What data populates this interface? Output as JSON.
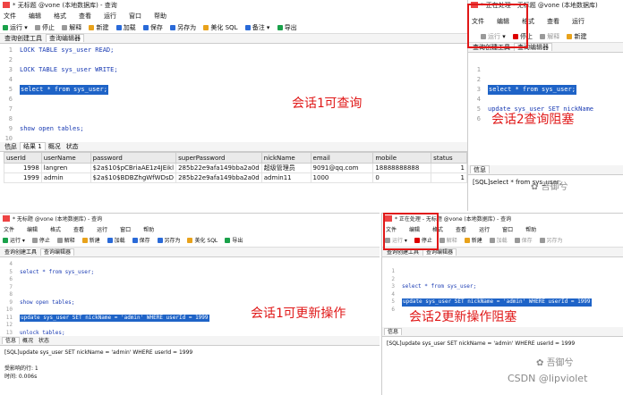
{
  "w1": {
    "title": "* 无标题 @vone (本地数据库) - 查询",
    "menu": [
      "文件",
      "编辑",
      "格式",
      "查看",
      "运行",
      "窗口",
      "帮助"
    ],
    "toolbar": [
      "运行",
      "停止",
      "解释",
      "新建",
      "加载",
      "保存",
      "另存为",
      "美化 SQL",
      "备注",
      "导出"
    ],
    "tabs": [
      "查询创建工具",
      "查询编辑器"
    ],
    "lines": [
      {
        "n": "1",
        "code": "LOCK TABLE sys_user READ;"
      },
      {
        "n": "2",
        "code": ""
      },
      {
        "n": "3",
        "code": "LOCK TABLE sys_user WRITE;"
      },
      {
        "n": "4",
        "code": ""
      },
      {
        "n": "5",
        "code": "select * from sys_user;"
      },
      {
        "n": "6",
        "code": ""
      },
      {
        "n": "7",
        "code": ""
      },
      {
        "n": "8",
        "code": ""
      },
      {
        "n": "9",
        "code": "show open tables;"
      },
      {
        "n": "10",
        "code": ""
      },
      {
        "n": "11",
        "code": ""
      }
    ],
    "annotation": "会话1可查询",
    "result_tabs": [
      "信息",
      "结果 1",
      "概况",
      "状态"
    ],
    "columns": [
      "userId",
      "userName",
      "password",
      "superPassword",
      "nickName",
      "email",
      "mobile",
      "status"
    ],
    "rows": [
      [
        "1998",
        "langren",
        "$2a$10$pCBriaAE1z4JEikl",
        "285b22e9afa149bba2a0d",
        "超级管理员",
        "9091@qq.com",
        "18888888888",
        "1"
      ],
      [
        "1999",
        "admin",
        "$2a$10$BDBZhgWfWDsD",
        "285b22e9afa149bba2a0d",
        "admin11",
        "1000",
        "0",
        "1"
      ]
    ]
  },
  "w2": {
    "title": "* 正在处理 - 无标题 @vone (本地数据库)",
    "menu": [
      "文件",
      "编辑",
      "格式",
      "查看",
      "运行"
    ],
    "toolbar": [
      "运行",
      "停止",
      "解释",
      "新建"
    ],
    "tabs": [
      "查询创建工具",
      "查询编辑器"
    ],
    "lines": [
      {
        "n": "1",
        "code": ""
      },
      {
        "n": "2",
        "code": ""
      },
      {
        "n": "3",
        "code": "select * from sys_user;"
      },
      {
        "n": "4",
        "code": ""
      },
      {
        "n": "5",
        "code": "update sys_user SET nickName"
      },
      {
        "n": "6",
        "code": ""
      }
    ],
    "annotation": "会话2查询阻塞",
    "info_tab": "信息",
    "message": "[SQL]select * from sys_user;",
    "watermark": "吾御兮"
  },
  "w3": {
    "title": "* 无标题 @vone (本地数据库) - 查询",
    "menu": [
      "文件",
      "编辑",
      "格式",
      "查看",
      "运行",
      "窗口",
      "帮助"
    ],
    "toolbar": [
      "运行",
      "停止",
      "解释",
      "新建",
      "加载",
      "保存",
      "另存为",
      "美化 SQL",
      "导出"
    ],
    "tabs": [
      "查询创建工具",
      "查询编辑器"
    ],
    "lines": [
      {
        "n": "4",
        "code": ""
      },
      {
        "n": "5",
        "code": "select * from sys_user;"
      },
      {
        "n": "6",
        "code": ""
      },
      {
        "n": "7",
        "code": ""
      },
      {
        "n": "8",
        "code": ""
      },
      {
        "n": "9",
        "code": "show open tables;"
      },
      {
        "n": "10",
        "code": ""
      },
      {
        "n": "11",
        "code": "update sys_user SET nickName = 'admin' WHERE userId = 1999"
      },
      {
        "n": "12",
        "code": ""
      },
      {
        "n": "13",
        "code": "unlock tables;"
      }
    ],
    "annotation": "会话1可更新操作",
    "result_tabs": [
      "信息",
      "概况",
      "状态"
    ],
    "messages": [
      "[SQL]update sys_user SET nickName = 'admin' WHERE userId = 1999",
      "",
      "受影响的行: 1",
      "时间: 0.006s"
    ]
  },
  "w4": {
    "title": "* 正在处理 - 无标题 @vone (本地数据库) - 查询",
    "menu": [
      "文件",
      "编辑",
      "格式",
      "查看",
      "运行",
      "窗口",
      "帮助"
    ],
    "toolbar": [
      "运行",
      "停止",
      "解释",
      "新建",
      "加载",
      "保存",
      "另存为"
    ],
    "tabs": [
      "查询创建工具",
      "查询编辑器"
    ],
    "lines": [
      {
        "n": "1",
        "code": ""
      },
      {
        "n": "2",
        "code": ""
      },
      {
        "n": "3",
        "code": "select * from sys_user;"
      },
      {
        "n": "4",
        "code": ""
      },
      {
        "n": "5",
        "code": "update sys_user SET nickName = 'admin' WHERE userId = 1999"
      },
      {
        "n": "6",
        "code": ""
      }
    ],
    "annotation": "会话2更新操作阻塞",
    "info_tab": "信息",
    "message": "[SQL]update sys_user SET nickName = 'admin' WHERE userId = 1999",
    "watermark": "吾御兮",
    "csdn": "CSDN @lipviolet"
  }
}
